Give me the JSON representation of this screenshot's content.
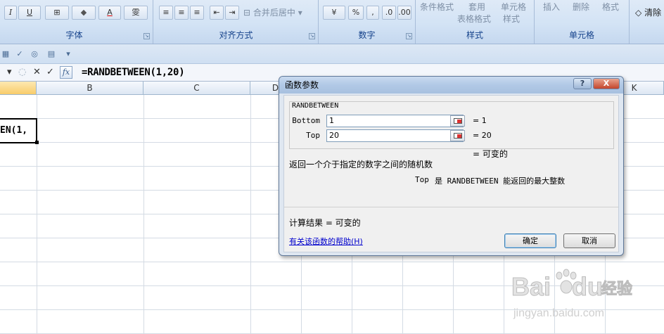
{
  "ribbon": {
    "font_group": {
      "label": "字体",
      "buttons": [
        "I",
        "U",
        "A",
        "雯"
      ]
    },
    "align_group": {
      "label": "对齐方式",
      "merge_center": "合并后居中"
    },
    "number_group": {
      "label": "数字",
      "percent": "%",
      "comma": ","
    },
    "styles_group": {
      "label": "样式",
      "conditional": "条件格式",
      "table_format_top": "套用",
      "table_format": "表格格式",
      "cell_style_top": "单元格",
      "cell_style": "样式"
    },
    "cells_group": {
      "label": "单元格",
      "insert": "插入",
      "delete": "删除",
      "format": "格式"
    },
    "clear": "清除"
  },
  "formula_bar": {
    "formula": "=RANDBETWEEN(1,20)"
  },
  "sheet": {
    "columns": [
      "B",
      "C",
      "D",
      "K"
    ],
    "cell_fragment": "EN(1,"
  },
  "dialog": {
    "title": "函数参数",
    "close_label": "X",
    "help_label": "?",
    "function_name": "RANDBETWEEN",
    "args": [
      {
        "label": "Bottom",
        "value": "1",
        "result": "= 1"
      },
      {
        "label": "Top",
        "value": "20",
        "result": "= 20"
      }
    ],
    "overall_result": "= 可变的",
    "description": "返回一个介于指定的数字之间的随机数",
    "arg_help_name": "Top",
    "arg_help_text": "是 RANDBETWEEN 能返回的最大整数",
    "calc_result": "计算结果 =  可变的",
    "help_link": "有关该函数的帮助(H)",
    "ok": "确定",
    "cancel": "取消"
  },
  "watermark": {
    "brand_top": "Bai",
    "brand_mid": "du",
    "brand_cn": "经验",
    "url": "jingyan.baidu.com"
  }
}
